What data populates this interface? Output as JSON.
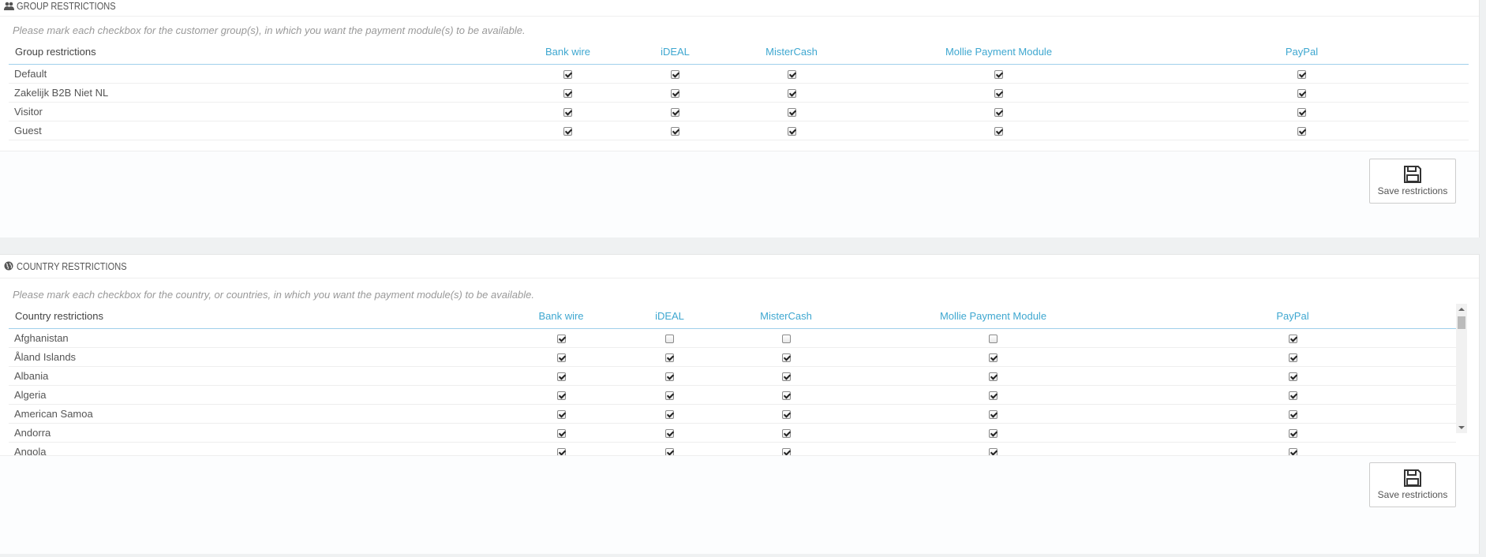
{
  "group_panel": {
    "title": "Group restrictions",
    "help": "Please mark each checkbox for the customer group(s), in which you want the payment module(s) to be available.",
    "first_column": "Group restrictions",
    "columns": [
      "Bank wire",
      "iDEAL",
      "MisterCash",
      "Mollie Payment Module",
      "PayPal"
    ],
    "rows": [
      {
        "name": "Default",
        "checks": [
          true,
          true,
          true,
          true,
          true
        ]
      },
      {
        "name": "Zakelijk B2B Niet NL",
        "checks": [
          true,
          true,
          true,
          true,
          true
        ]
      },
      {
        "name": "Visitor",
        "checks": [
          true,
          true,
          true,
          true,
          true
        ]
      },
      {
        "name": "Guest",
        "checks": [
          true,
          true,
          true,
          true,
          true
        ]
      }
    ],
    "save_label": "Save restrictions"
  },
  "country_panel": {
    "title": "Country restrictions",
    "help": "Please mark each checkbox for the country, or countries, in which you want the payment module(s) to be available.",
    "first_column": "Country restrictions",
    "columns": [
      "Bank wire",
      "iDEAL",
      "MisterCash",
      "Mollie Payment Module",
      "PayPal"
    ],
    "rows": [
      {
        "name": "Afghanistan",
        "checks": [
          true,
          false,
          false,
          false,
          true
        ]
      },
      {
        "name": "Åland Islands",
        "checks": [
          true,
          true,
          true,
          true,
          true
        ]
      },
      {
        "name": "Albania",
        "checks": [
          true,
          true,
          true,
          true,
          true
        ]
      },
      {
        "name": "Algeria",
        "checks": [
          true,
          true,
          true,
          true,
          true
        ]
      },
      {
        "name": "American Samoa",
        "checks": [
          true,
          true,
          true,
          true,
          true
        ]
      },
      {
        "name": "Andorra",
        "checks": [
          true,
          true,
          true,
          true,
          true
        ]
      },
      {
        "name": "Angola",
        "checks": [
          true,
          true,
          true,
          true,
          true
        ]
      }
    ],
    "save_label": "Save restrictions"
  },
  "icons": {
    "group": "users-icon",
    "country": "globe-icon",
    "save": "floppy-disk-icon"
  },
  "colors": {
    "accent": "#3ea7d0",
    "header_rule": "#a0d0eb"
  }
}
